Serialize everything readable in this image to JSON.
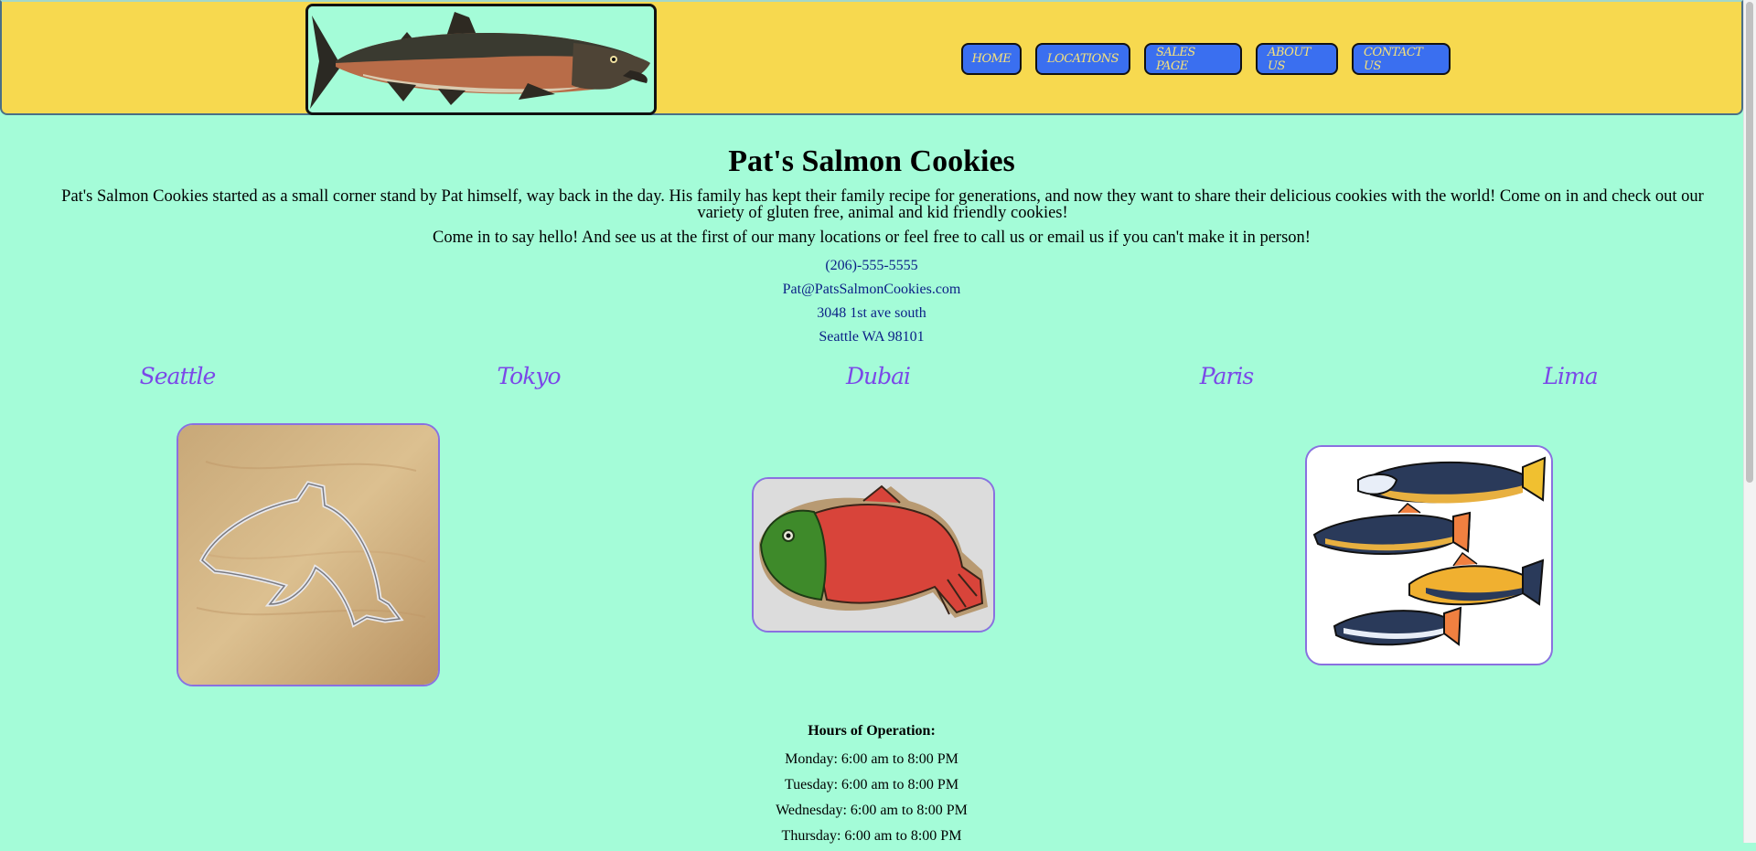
{
  "nav": {
    "items": [
      {
        "label": "HOME"
      },
      {
        "label": "LOCATIONS"
      },
      {
        "label": "SALES PAGE"
      },
      {
        "label": "ABOUT US"
      },
      {
        "label": "CONTACT US"
      }
    ]
  },
  "main": {
    "title": "Pat's Salmon Cookies",
    "intro": "Pat's Salmon Cookies started as a small corner stand by Pat himself, way back in the day. His family has kept their family recipe for generations, and now they want to share their delicious cookies with the world! Come on in and check out our variety of gluten free, animal and kid friendly cookies!",
    "intro2": "Come in to say hello! And see us at the first of our many locations or feel free to call us or email us if you can't make it in person!"
  },
  "contact": {
    "phone": "(206)-555-5555",
    "email": "Pat@PatsSalmonCookies.com",
    "street": "3048 1st ave south",
    "city_line": "Seattle WA 98101"
  },
  "cities": [
    "Seattle",
    "Tokyo",
    "Dubai",
    "Paris",
    "Lima"
  ],
  "hours": {
    "title": "Hours of Operation:",
    "days": [
      "Monday: 6:00 am to 8:00 PM",
      "Tuesday: 6:00 am to 8:00 PM",
      "Wednesday: 6:00 am to 8:00 PM",
      "Thursday: 6:00 am to 8:00 PM"
    ]
  },
  "colors": {
    "page_background": "#a4fcd8",
    "header_background": "#f7d94f",
    "nav_button": "#3a6ff0",
    "nav_text": "#f7e27a",
    "city_text": "#7b48e8",
    "contact_text": "#0b1f86"
  }
}
